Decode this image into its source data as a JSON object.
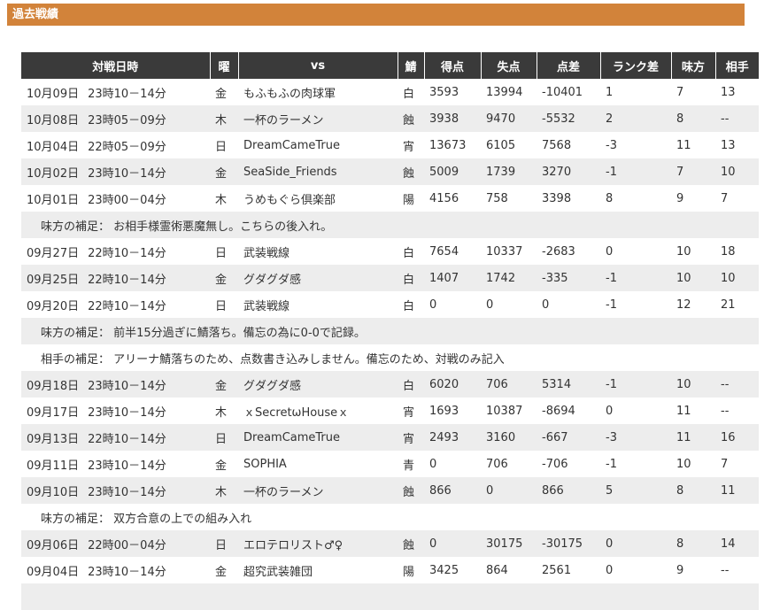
{
  "section": {
    "title": "過去戦績"
  },
  "headers": [
    "対戦日時",
    "曜",
    "vs",
    "鯖",
    "得点",
    "失点",
    "点差",
    "ランク差",
    "味方",
    "相手"
  ],
  "rows": [
    {
      "kind": "match",
      "date": "10月09日",
      "time": "23時10－14分",
      "dow": "金",
      "vs": "もふもふの肉球軍",
      "server": "白",
      "score": "3593",
      "lost": "13994",
      "diff": "-10401",
      "rank": "1",
      "ally": "7",
      "opp": "13"
    },
    {
      "kind": "match",
      "date": "10月08日",
      "time": "23時05－09分",
      "dow": "木",
      "vs": "一杯のラーメン",
      "server": "蝕",
      "score": "3938",
      "lost": "9470",
      "diff": "-5532",
      "rank": "2",
      "ally": "8",
      "opp": "--"
    },
    {
      "kind": "match",
      "date": "10月04日",
      "time": "22時05－09分",
      "dow": "日",
      "vs": "DreamCameTrue",
      "server": "宵",
      "score": "13673",
      "lost": "6105",
      "diff": "7568",
      "rank": "-3",
      "ally": "11",
      "opp": "13"
    },
    {
      "kind": "match",
      "date": "10月02日",
      "time": "23時10－14分",
      "dow": "金",
      "vs": "SeaSide_Friends",
      "server": "蝕",
      "score": "5009",
      "lost": "1739",
      "diff": "3270",
      "rank": "-1",
      "ally": "7",
      "opp": "10"
    },
    {
      "kind": "match",
      "date": "10月01日",
      "time": "23時00－04分",
      "dow": "木",
      "vs": "うめもぐら倶楽部",
      "server": "陽",
      "score": "4156",
      "lost": "758",
      "diff": "3398",
      "rank": "8",
      "ally": "9",
      "opp": "7"
    },
    {
      "kind": "note",
      "text": "味方の補足： お相手様霊術悪魔無し。こちらの後入れ。"
    },
    {
      "kind": "match",
      "date": "09月27日",
      "time": "22時10－14分",
      "dow": "日",
      "vs": "武装戦線",
      "server": "白",
      "score": "7654",
      "lost": "10337",
      "diff": "-2683",
      "rank": "0",
      "ally": "10",
      "opp": "18"
    },
    {
      "kind": "match",
      "date": "09月25日",
      "time": "22時10－14分",
      "dow": "金",
      "vs": "グダグダ感",
      "server": "白",
      "score": "1407",
      "lost": "1742",
      "diff": "-335",
      "rank": "-1",
      "ally": "10",
      "opp": "10"
    },
    {
      "kind": "match",
      "date": "09月20日",
      "time": "22時10－14分",
      "dow": "日",
      "vs": "武装戦線",
      "server": "白",
      "score": "0",
      "lost": "0",
      "diff": "0",
      "rank": "-1",
      "ally": "12",
      "opp": "21"
    },
    {
      "kind": "note",
      "text": "味方の補足： 前半15分過ぎに鯖落ち。備忘の為に0-0で記録。"
    },
    {
      "kind": "note",
      "text": "相手の補足： アリーナ鯖落ちのため、点数書き込みしません。備忘のため、対戦のみ記入"
    },
    {
      "kind": "match",
      "date": "09月18日",
      "time": "23時10－14分",
      "dow": "金",
      "vs": "グダグダ感",
      "server": "白",
      "score": "6020",
      "lost": "706",
      "diff": "5314",
      "rank": "-1",
      "ally": "10",
      "opp": "--"
    },
    {
      "kind": "match",
      "date": "09月17日",
      "time": "23時10－14分",
      "dow": "木",
      "vs": "ｘSecretωHouseｘ",
      "server": "宵",
      "score": "1693",
      "lost": "10387",
      "diff": "-8694",
      "rank": "0",
      "ally": "11",
      "opp": "--"
    },
    {
      "kind": "match",
      "date": "09月13日",
      "time": "22時10－14分",
      "dow": "日",
      "vs": "DreamCameTrue",
      "server": "宵",
      "score": "2493",
      "lost": "3160",
      "diff": "-667",
      "rank": "-3",
      "ally": "11",
      "opp": "16"
    },
    {
      "kind": "match",
      "date": "09月11日",
      "time": "23時10－14分",
      "dow": "金",
      "vs": "SOPHIA",
      "server": "青",
      "score": "0",
      "lost": "706",
      "diff": "-706",
      "rank": "-1",
      "ally": "10",
      "opp": "7"
    },
    {
      "kind": "match",
      "date": "09月10日",
      "time": "23時10－14分",
      "dow": "木",
      "vs": "一杯のラーメン",
      "server": "蝕",
      "score": "866",
      "lost": "0",
      "diff": "866",
      "rank": "5",
      "ally": "8",
      "opp": "11"
    },
    {
      "kind": "note",
      "text": "味方の補足： 双方合意の上での組み入れ"
    },
    {
      "kind": "match",
      "date": "09月06日",
      "time": "22時00－04分",
      "dow": "日",
      "vs": "エロテロリスト♂♀",
      "server": "蝕",
      "score": "0",
      "lost": "30175",
      "diff": "-30175",
      "rank": "0",
      "ally": "8",
      "opp": "14"
    },
    {
      "kind": "match",
      "date": "09月04日",
      "time": "23時10－14分",
      "dow": "金",
      "vs": "超究武装雑団",
      "server": "陽",
      "score": "3425",
      "lost": "864",
      "diff": "2561",
      "rank": "0",
      "ally": "9",
      "opp": "--"
    },
    {
      "kind": "note",
      "text": ""
    }
  ]
}
